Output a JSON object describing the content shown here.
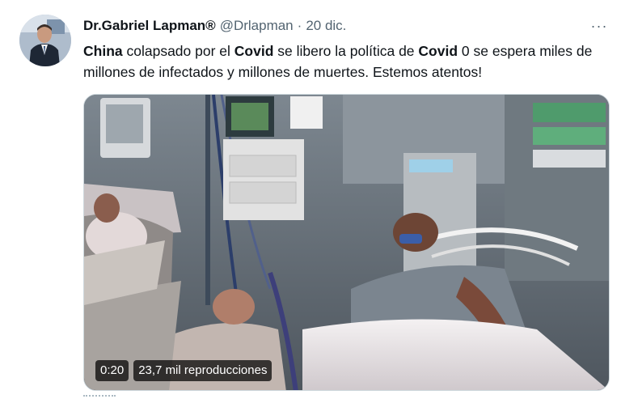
{
  "author": {
    "name": "Dr.Gabriel Lapman®",
    "handle": "@Drlapman",
    "separator": "·",
    "date": "20 dic."
  },
  "more_menu": {
    "label": "···",
    "icon": "more-icon"
  },
  "tweet": {
    "segments": [
      {
        "text": "China",
        "bold": true
      },
      {
        "text": " colapsado por el ",
        "bold": false
      },
      {
        "text": "Covid",
        "bold": true
      },
      {
        "text": " se libero la política de ",
        "bold": false
      },
      {
        "text": "Covid",
        "bold": true
      },
      {
        "text": " 0 se espera miles de millones de infectados y millones de muertes. Estemos atentos!",
        "bold": false
      }
    ]
  },
  "video": {
    "duration": "0:20",
    "views": "23,7 mil reproducciones"
  },
  "colors": {
    "text_primary": "#0f1419",
    "text_secondary": "#536471",
    "overlay_bg": "#000000b8"
  }
}
